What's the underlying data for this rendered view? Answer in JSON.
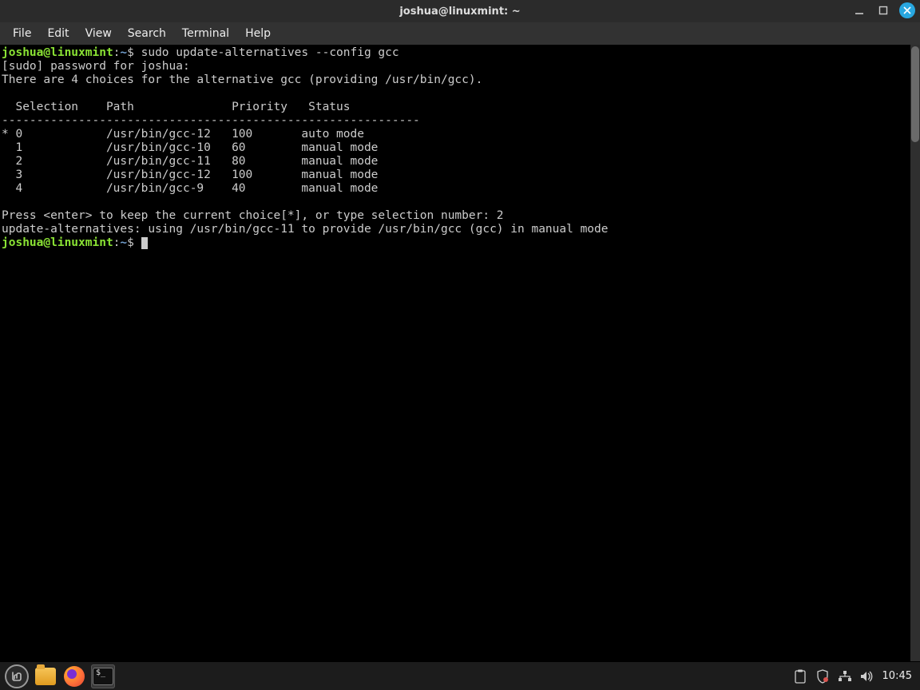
{
  "window": {
    "title": "joshua@linuxmint: ~"
  },
  "menubar": {
    "items": [
      "File",
      "Edit",
      "View",
      "Search",
      "Terminal",
      "Help"
    ]
  },
  "terminal": {
    "prompt": {
      "user_host": "joshua@linuxmint",
      "sep": ":",
      "path": "~",
      "dollar": "$"
    },
    "lines": {
      "cmd1": " sudo update-alternatives --config gcc",
      "sudo_prompt": "[sudo] password for joshua: ",
      "intro": "There are 4 choices for the alternative gcc (providing /usr/bin/gcc).",
      "blank": "",
      "header": "  Selection    Path              Priority   Status",
      "divider": "------------------------------------------------------------",
      "row0": "* 0            /usr/bin/gcc-12   100       auto mode",
      "row1": "  1            /usr/bin/gcc-10   60        manual mode",
      "row2": "  2            /usr/bin/gcc-11   80        manual mode",
      "row3": "  3            /usr/bin/gcc-12   100       manual mode",
      "row4": "  4            /usr/bin/gcc-9    40        manual mode",
      "press": "Press <enter> to keep the current choice[*], or type selection number: 2",
      "result": "update-alternatives: using /usr/bin/gcc-11 to provide /usr/bin/gcc (gcc) in manual mode"
    }
  },
  "taskbar": {
    "time": "10:45"
  },
  "colors": {
    "prompt_user": "#8ae234",
    "prompt_path": "#729fcf",
    "close_btn": "#28a7e0"
  }
}
